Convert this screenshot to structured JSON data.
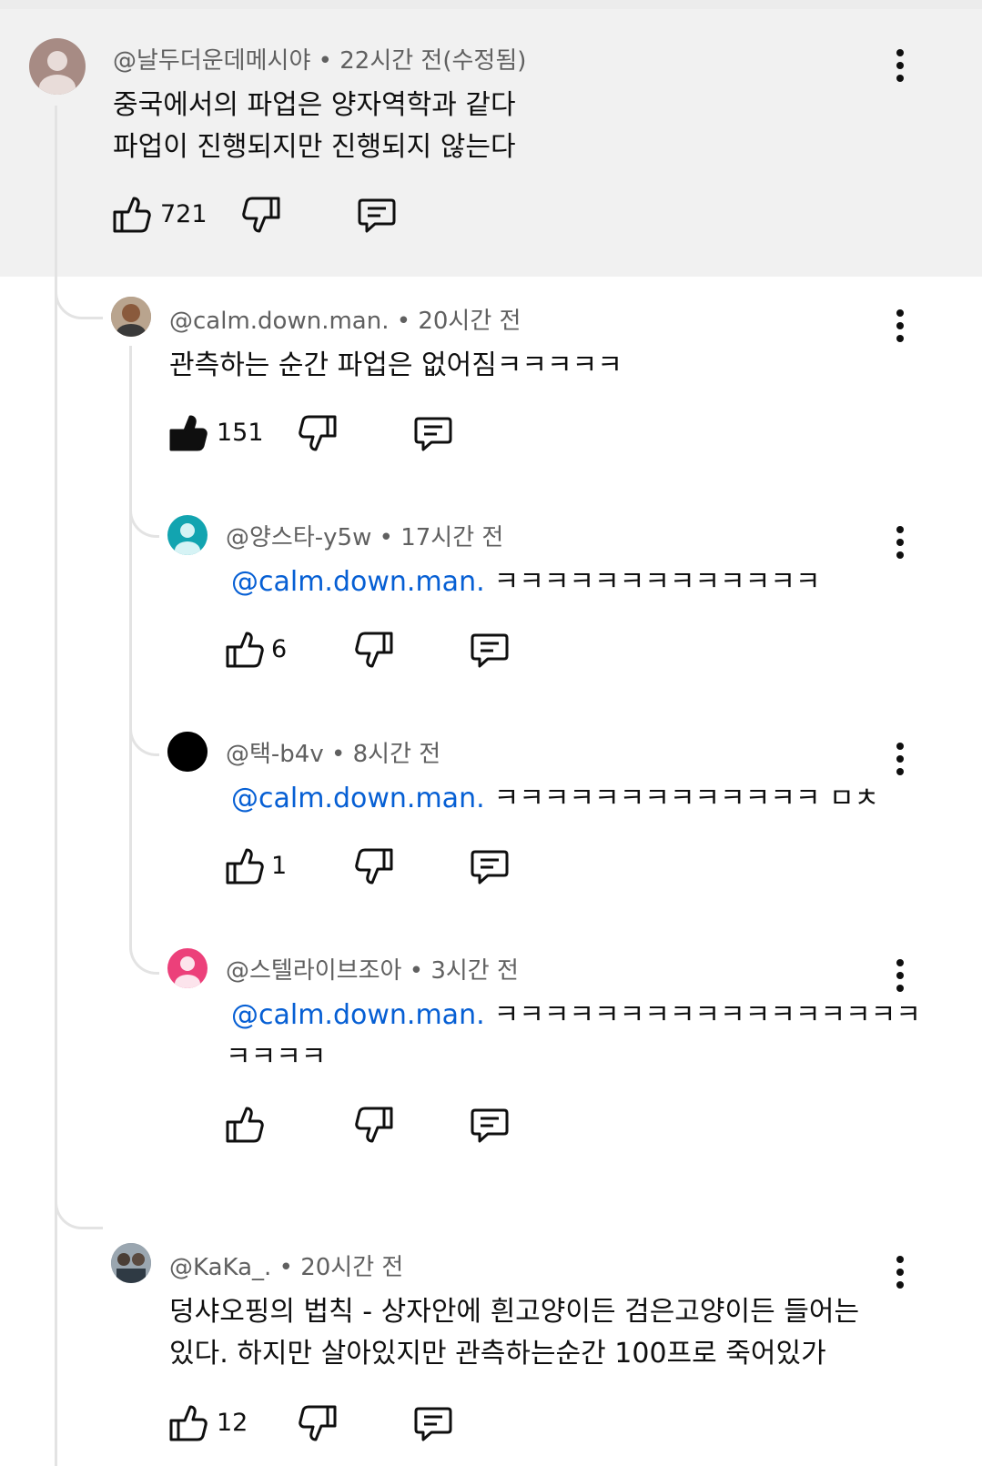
{
  "comments": [
    {
      "author": "@날두더운데메시야",
      "time": "• 22시간 전(수정됨)",
      "lines": [
        "중국에서의 파업은 양자역학과 같다",
        "파업이 진행되지만 진행되지 않는다"
      ],
      "likes": "721",
      "liked": false
    },
    {
      "author": "@calm.down.man.",
      "time": "• 20시간 전",
      "lines": [
        "관측하는 순간 파업은 없어짐ㅋㅋㅋㅋㅋ"
      ],
      "likes": "151",
      "liked": true
    },
    {
      "author": "@양스타-y5w",
      "time": "• 17시간 전",
      "mention": "@calm.down.man.",
      "lines": [
        "ㅋㅋㅋㅋㅋㅋㅋㅋㅋㅋㅋㅋㅋ"
      ],
      "likes": "6",
      "liked": false
    },
    {
      "author": "@택-b4v",
      "time": "• 8시간 전",
      "mention": "@calm.down.man.",
      "lines": [
        "ㅋㅋㅋㅋㅋㅋㅋㅋㅋㅋㅋㅋㅋ ㅁㅊ"
      ],
      "likes": "1",
      "liked": false
    },
    {
      "author": "@스텔라이브조아",
      "time": "• 3시간 전",
      "mention": "@calm.down.man.",
      "lines": [
        "ㅋㅋㅋㅋㅋㅋㅋㅋㅋㅋㅋㅋㅋㅋㅋㅋㅋ",
        "ㅋㅋㅋㅋ"
      ],
      "likes": "",
      "liked": false
    },
    {
      "author": "@KaKa_.",
      "time": "• 20시간 전",
      "lines": [
        "덩샤오핑의 법칙 - 상자안에 흰고양이든 검은고양이든 들어는",
        "있다. 하지만 살아있지만 관측하는순간 100프로 죽어있가"
      ],
      "likes": "12",
      "liked": false
    }
  ],
  "colors": {
    "highlight_bg": "#f1f1f1",
    "mention": "#065fd4",
    "meta": "#606060",
    "thread_line": "#e3e3e3"
  },
  "icons": [
    "like-icon",
    "dislike-icon",
    "reply-icon",
    "more-vert-icon",
    "avatar-icon"
  ]
}
